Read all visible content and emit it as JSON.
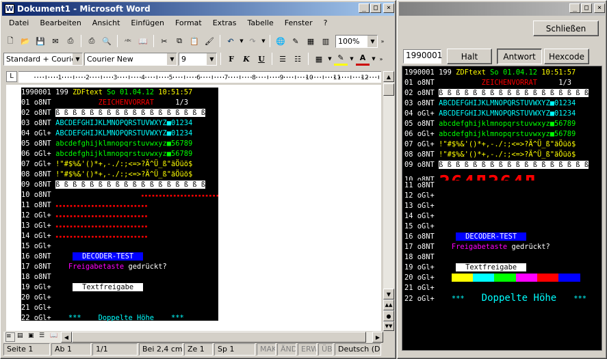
{
  "word": {
    "title": "Dokument1 - Microsoft Word",
    "menu": [
      "Datei",
      "Bearbeiten",
      "Ansicht",
      "Einfügen",
      "Format",
      "Extras",
      "Tabelle",
      "Fenster",
      "?"
    ],
    "zoom": "100%",
    "style": "Standard + Courier",
    "font": "Courier New",
    "size": "9",
    "bold": "F",
    "italic": "K",
    "underline": "U",
    "ruler_numbers": [
      "1",
      "2",
      "3",
      "4",
      "5",
      "6",
      "7",
      "8",
      "9",
      "10",
      "11",
      "12",
      "13"
    ],
    "status": {
      "page": "Seite  1",
      "section": "Ab  1",
      "pages": "1/1",
      "at": "Bei  2,4 cm",
      "line": "Ze  1",
      "col": "Sp  1",
      "mak": "MAK",
      "aend": "ÄND",
      "erw": "ERW",
      "ueb": "ÜB",
      "lang": "Deutsch (De"
    }
  },
  "teletext": {
    "close_label": "Schließen",
    "page_input": "1990001",
    "halt_label": "Halt",
    "antwort_label": "Antwort",
    "hexcode_label": "Hexcode",
    "bottom_text": "***   Doppelte Höhe    ***",
    "row_codes": [
      "01 o8NT",
      "02 o8NT",
      "03 o8NT",
      "04 oGl+",
      "05 o8NT",
      "06 oGl+",
      "07 oGl+",
      "08 o8NT",
      "09 o8NT",
      "10 o8NT",
      "11 o8NT",
      "12 oGl+",
      "13 oGl+",
      "14 oGl+",
      "15 oGl+",
      "16 o8NT",
      "17 o8NT",
      "18 o8NT",
      "19 oGl+",
      "20 oGl+",
      "21 oGl+",
      "22 oGl+"
    ],
    "header": {
      "num": "1990001",
      "pg": "199",
      "name": "ZDFtext",
      "date": "So 01.04.12",
      "time": "10:51:57"
    },
    "title_line": "ZEICHENVORRAT",
    "page_frac": "1/3",
    "lines": {
      "upper": "ABCDEFGHIJKLMNOPQRSTUVWXYZ",
      "digits1": "01234",
      "lower": "abcdefghijklmnopqrstuvwxyz",
      "digits2": "56789",
      "punct": "!\"#$%&'()*+,-./:;<=>?Ä^Ü_ß\"äÖüö$",
      "ss_row": "ß ß ß ß ß ß ß ß ß ß ß ß ß ß ß ß ß ß",
      "big": "364Д364Д",
      "decoder": "DECODER-TEST",
      "freigabe": "Freigabetaste",
      "gedrueckt": "gedrückt?",
      "textfreigabe": "Textfreigabe",
      "stars": "***",
      "doppelt": "Doppelte Höhe"
    }
  }
}
